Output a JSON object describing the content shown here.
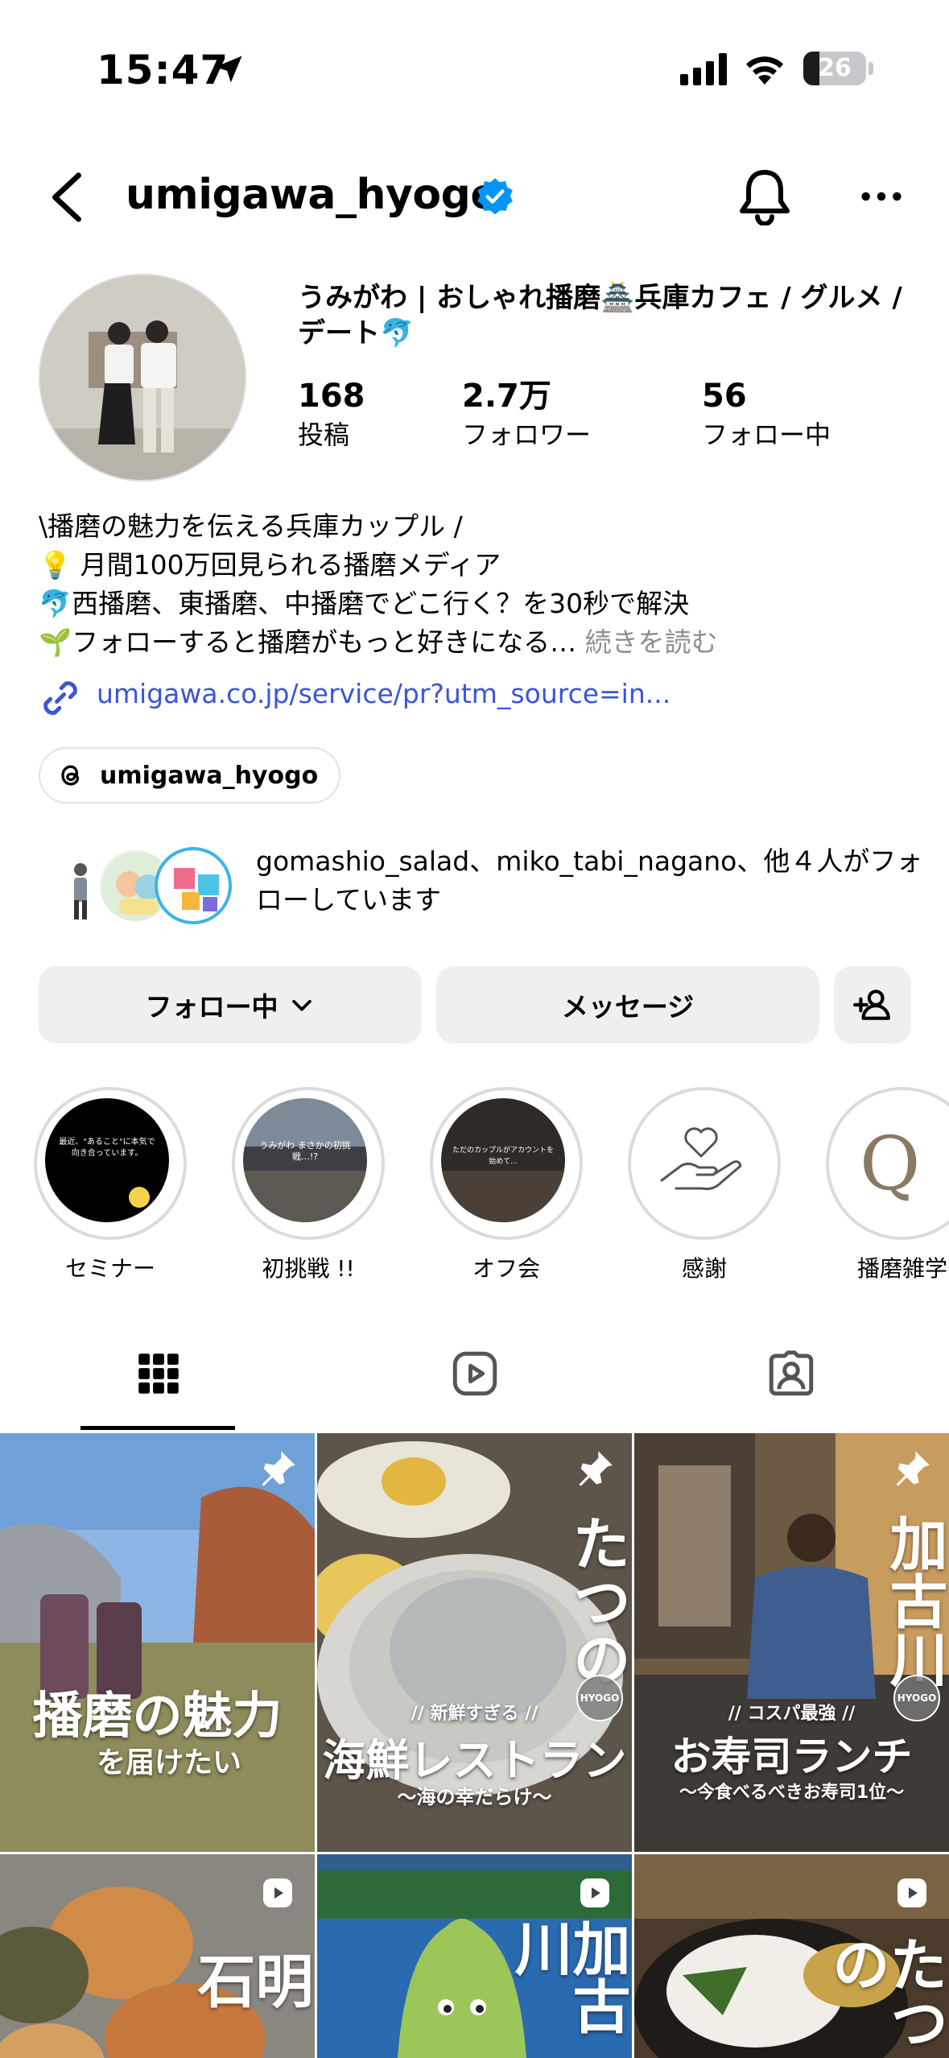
{
  "status_bar": {
    "time": "15:47",
    "battery": "26",
    "battery_level_percent": 26,
    "icons": [
      "location-arrow-icon",
      "cellular-signal-icon",
      "wifi-icon",
      "battery-icon"
    ]
  },
  "nav": {
    "username": "umigawa_hyogo",
    "icons": [
      "back-chevron-icon",
      "verified-badge-icon",
      "bell-icon",
      "more-dots-icon"
    ]
  },
  "profile": {
    "display_name": "うみがわ | おしゃれ播磨🏯兵庫カフェ / グルメ / デート🐬",
    "stats": [
      {
        "value": "168",
        "label": "投稿"
      },
      {
        "value": "2.7万",
        "label": "フォロワー"
      },
      {
        "value": "56",
        "label": "フォロー中"
      }
    ],
    "bio": {
      "line1": "\\播磨の魅力を伝える兵庫カップル /",
      "line2": "💡 月間100万回見られる播磨メディア",
      "line3": "🐬西播磨、東播磨、中播磨でどこ行く？を30秒で解決",
      "line4": "🌱フォローすると播磨がもっと好きになる…",
      "more": "続きを読む"
    },
    "link": "umigawa.co.jp/service/pr?utm_source=in...",
    "threads": "umigawa_hyogo",
    "mutual_followers": "gomashio_salad、miko_tabi_nagano、他４人がフォローしています"
  },
  "buttons": {
    "following": "フォロー中",
    "message": "メッセージ"
  },
  "highlights": [
    {
      "label": "セミナー",
      "cover_text": "最近、\"あること\"に本気で向き合っています。"
    },
    {
      "label": "初挑戦 !!",
      "cover_text": "うみがわ まさかの初挑戦…!?"
    },
    {
      "label": "オフ会",
      "cover_text": "ただのカップルがアカウントを始めて..."
    },
    {
      "label": "感謝",
      "cover_text": ""
    },
    {
      "label": "播磨雑学",
      "cover_text": "Q"
    }
  ],
  "tabs": [
    {
      "name": "posts-grid",
      "icon": "grid-icon",
      "active": true
    },
    {
      "name": "reels",
      "icon": "reels-icon",
      "active": false
    },
    {
      "name": "tagged",
      "icon": "tagged-person-icon",
      "active": false
    }
  ],
  "posts": [
    {
      "title": "播磨の魅力",
      "subtitle": "を届けたい",
      "pinned": true
    },
    {
      "vertical": "たつの",
      "kicker": "// 新鮮すぎる //",
      "title": "海鮮レストラン",
      "subtitle": "〜海の幸だらけ〜",
      "badge": "HYOGO",
      "pinned": true
    },
    {
      "vertical": "加古川",
      "kicker": "// コスパ最強 //",
      "title": "お寿司ランチ",
      "subtitle": "〜今食べるべきお寿司1位〜",
      "badge": "HYOGO",
      "pinned": true
    },
    {
      "vertical": "明石",
      "reel": true
    },
    {
      "vertical": "加古川",
      "reel": true
    },
    {
      "vertical": "たつの",
      "reel": true
    }
  ],
  "colors": {
    "accent_link": "#3a55d6",
    "verified": "#0095f6",
    "button_bg": "#efefef"
  }
}
